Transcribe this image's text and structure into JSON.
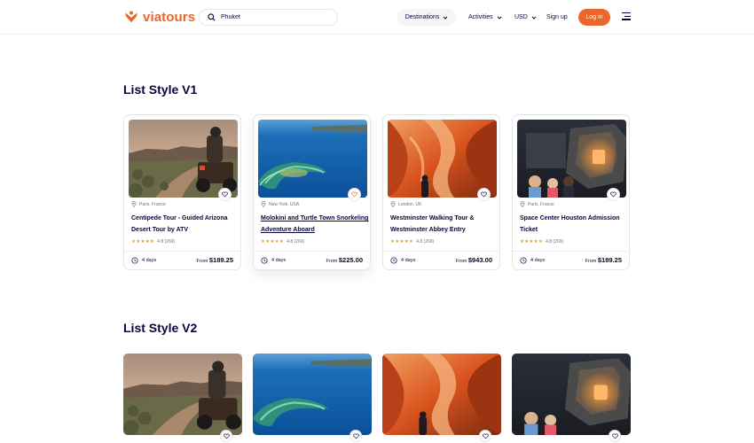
{
  "brand": {
    "name": "viatours",
    "accent": "#eb662b"
  },
  "search": {
    "value": "Phuket",
    "icon": "search-icon"
  },
  "nav": {
    "destinations": "Destinations",
    "activities": "Activities",
    "currency": "USD",
    "signup": "Sign up",
    "login": "Log in",
    "menu_icon": "hamburger-menu-icon"
  },
  "sections": {
    "v1_title": "List Style V1",
    "v2_title": "List Style V2"
  },
  "tours": [
    {
      "location": "Paris, France",
      "title": "Centipede Tour - Guided Arizona Desert Tour by ATV",
      "rating": "4.8 (269)",
      "duration": "4 days",
      "price_prefix": "From",
      "price": "$189.25"
    },
    {
      "location": "New York, USA",
      "title": "Molokini and Turtle Town Snorkeling Adventure Aboard",
      "rating": "4.8 (269)",
      "duration": "4 days",
      "price_prefix": "From",
      "price": "$225.00"
    },
    {
      "location": "London, UK",
      "title": "Westminster Walking Tour & Westminster Abbey Entry",
      "rating": "4.8 (269)",
      "duration": "4 days",
      "price_prefix": "From",
      "price": "$943.00"
    },
    {
      "location": "Paris, France",
      "title": "Space Center Houston Admission Ticket",
      "rating": "4.8 (269)",
      "duration": "4 days",
      "price_prefix": "From",
      "price": "$189.25"
    }
  ],
  "stars": "★★★★★"
}
